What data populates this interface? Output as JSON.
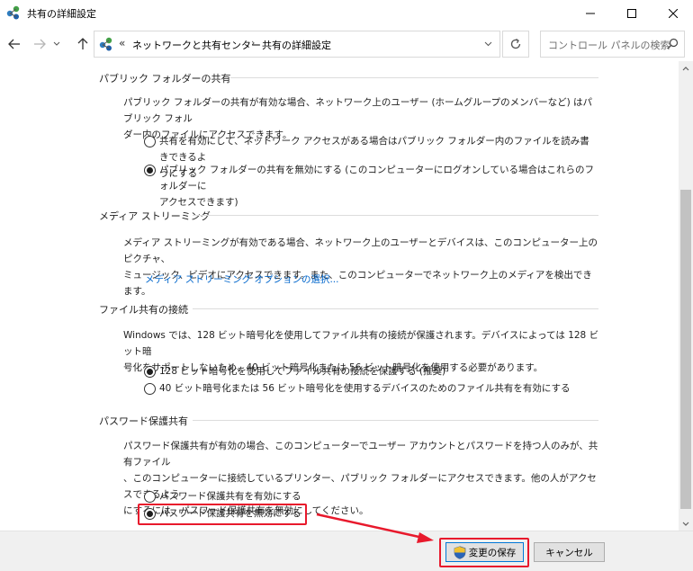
{
  "window": {
    "title": "共有の詳細設定"
  },
  "address": {
    "overflow": "«",
    "crumbs": [
      "ネットワークと共有センター",
      "共有の詳細設定"
    ],
    "separator": "›"
  },
  "search": {
    "placeholder": "コントロール パネルの検索"
  },
  "sections": {
    "public_folder": {
      "heading": "パブリック フォルダーの共有",
      "description_lines": [
        "パブリック フォルダーの共有が有効な場合、ネットワーク上のユーザー (ホームグループのメンバーなど) はパブリック フォル",
        "ダー内のファイルにアクセスできます。"
      ],
      "options": [
        {
          "lines": [
            "共有を有効にして、ネットワーク アクセスがある場合はパブリック フォルダー内のファイルを読み書きできるよ",
            "うにする"
          ],
          "checked": false
        },
        {
          "lines": [
            "パブリック フォルダーの共有を無効にする (このコンピューターにログオンしている場合はこれらのフォルダーに",
            "アクセスできます)"
          ],
          "checked": true
        }
      ]
    },
    "media": {
      "heading": "メディア ストリーミング",
      "description_lines": [
        "メディア ストリーミングが有効である場合、ネットワーク上のユーザーとデバイスは、このコンピューター上のピクチャ、",
        "ミュージック、ビデオにアクセスできます。また、このコンピューターでネットワーク上のメディアを検出できます。"
      ],
      "link": "メディア ストリーミング オプションの選択..."
    },
    "file_sharing": {
      "heading": "ファイル共有の接続",
      "description_lines": [
        "Windows では、128 ビット暗号化を使用してファイル共有の接続が保護されます。デバイスによっては 128 ビット暗",
        "号化をサポートしないため、40 ビット暗号化または 56 ビット暗号化を使用する必要があります。"
      ],
      "options": [
        {
          "lines": [
            "128 ビット暗号化を使用してファイル共有の接続を保護する (推奨)"
          ],
          "checked": true
        },
        {
          "lines": [
            "40 ビット暗号化または 56 ビット暗号化を使用するデバイスのためのファイル共有を有効にする"
          ],
          "checked": false
        }
      ]
    },
    "password": {
      "heading": "パスワード保護共有",
      "description_lines": [
        "パスワード保護共有が有効の場合、このコンピューターでユーザー アカウントとパスワードを持つ人のみが、共有ファイル",
        "、このコンピューターに接続しているプリンター、パブリック フォルダーにアクセスできます。他の人がアクセスできるよう",
        "にするには、パスワード保護共有を無効にしてください。"
      ],
      "options": [
        {
          "lines": [
            "パスワード保護共有を有効にする"
          ],
          "checked": false
        },
        {
          "lines": [
            "パスワード保護共有を無効にする"
          ],
          "checked": true
        }
      ]
    }
  },
  "buttons": {
    "save": "変更の保存",
    "cancel": "キャンセル"
  },
  "colors": {
    "highlight": "#e8192c",
    "link": "#0066cc",
    "accent": "#0078d7"
  }
}
